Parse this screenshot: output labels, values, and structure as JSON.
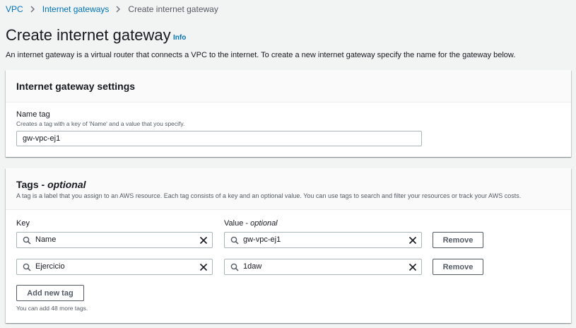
{
  "breadcrumb": {
    "items": [
      "VPC",
      "Internet gateways",
      "Create internet gateway"
    ]
  },
  "page": {
    "title": "Create internet gateway",
    "info_label": "Info",
    "description": "An internet gateway is a virtual router that connects a VPC to the internet. To create a new internet gateway specify the name for the gateway below."
  },
  "settings": {
    "title": "Internet gateway settings",
    "name_tag_label": "Name tag",
    "name_tag_desc": "Creates a tag with a key of 'Name' and a value that you specify.",
    "name_tag_value": "gw-vpc-ej1"
  },
  "tags": {
    "title_main": "Tags - ",
    "title_optional": "optional",
    "subtitle": "A tag is a label that you assign to an AWS resource. Each tag consists of a key and an optional value. You can use tags to search and filter your resources or track your AWS costs.",
    "key_label": "Key",
    "value_label_main": "Value - ",
    "value_label_optional": "optional",
    "rows": [
      {
        "key": "Name",
        "value": "gw-vpc-ej1",
        "remove_label": "Remove"
      },
      {
        "key": "Ejercicio",
        "value": "1daw",
        "remove_label": "Remove"
      }
    ],
    "add_button_label": "Add new tag",
    "remaining_hint": "You can add 48 more tags."
  },
  "colors": {
    "link": "#0073bb",
    "background": "#f2f3f3",
    "border": "#aab7b8"
  },
  "icons": {
    "separator": "chevron-right-icon",
    "search": "search-icon",
    "clear": "close-icon"
  }
}
